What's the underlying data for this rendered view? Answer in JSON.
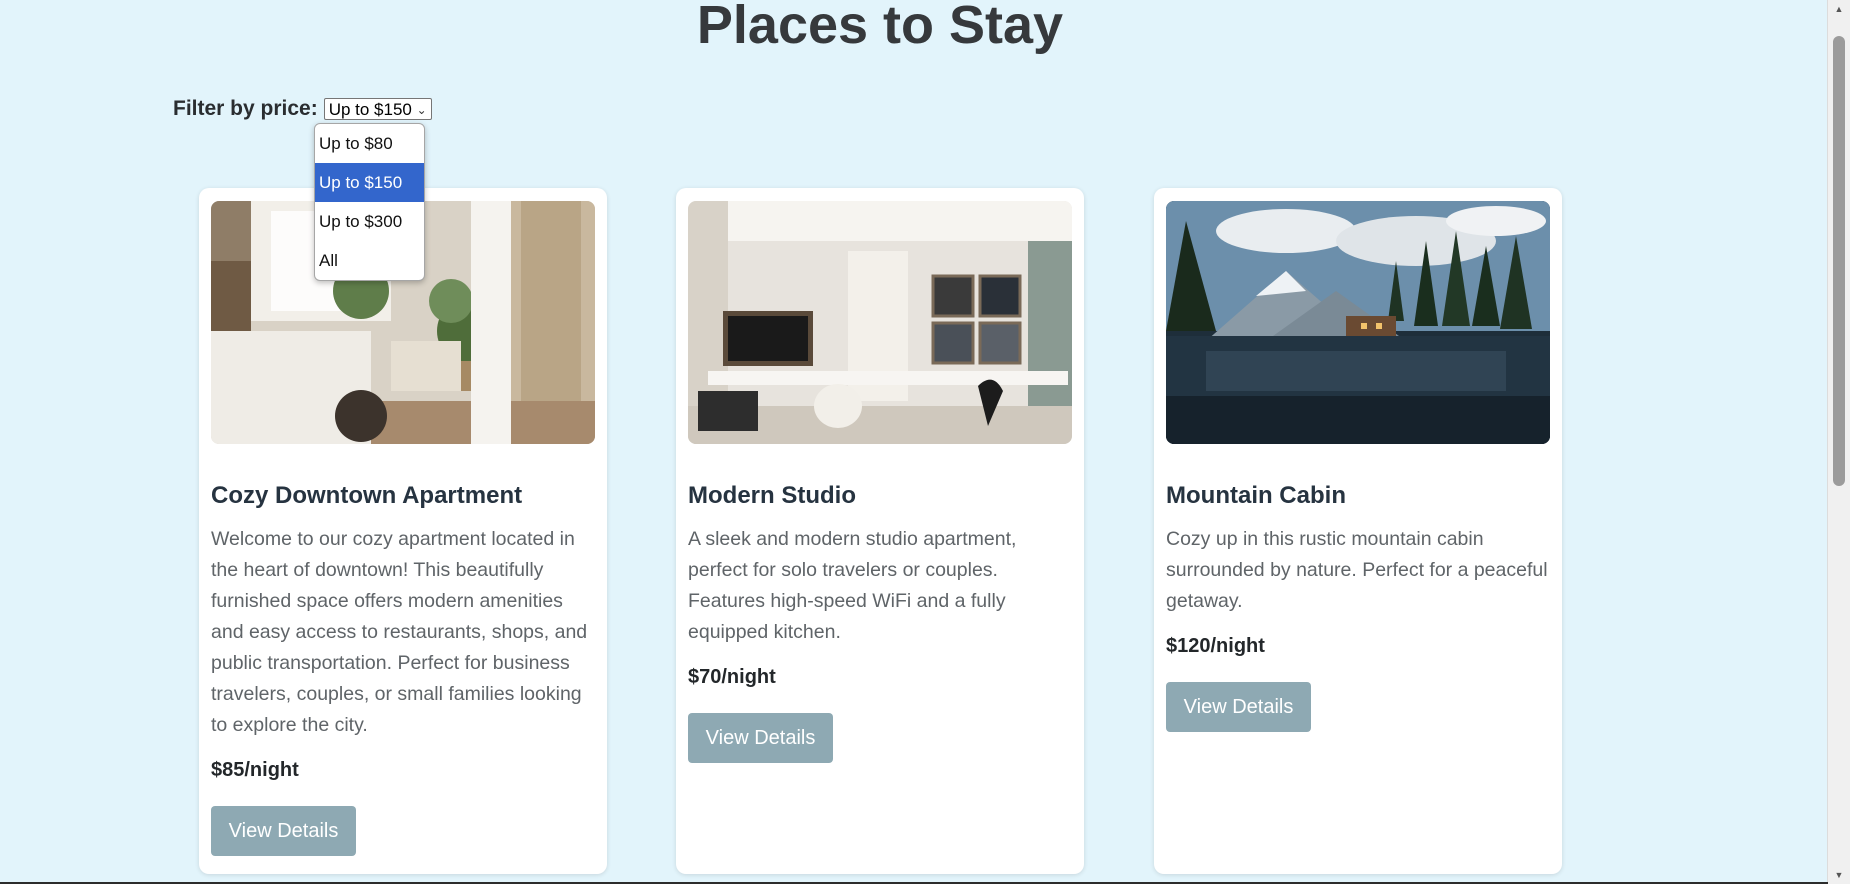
{
  "page": {
    "title": "Places to Stay"
  },
  "filter": {
    "label": "Filter by price:",
    "selected": "Up to $150",
    "options": [
      {
        "label": "Up to $80"
      },
      {
        "label": "Up to $150"
      },
      {
        "label": "Up to $300"
      },
      {
        "label": "All"
      }
    ]
  },
  "listings": [
    {
      "title": "Cozy Downtown Apartment",
      "description": "Welcome to our cozy apartment located in the heart of downtown! This beautifully furnished space offers modern amenities and easy access to restaurants, shops, and public transportation. Perfect for business travelers, couples, or small families looking to explore the city.",
      "price": "$85/night",
      "button_label": "View Details"
    },
    {
      "title": "Modern Studio",
      "description": "A sleek and modern studio apartment, perfect for solo travelers or couples. Features high-speed WiFi and a fully equipped kitchen.",
      "price": "$70/night",
      "button_label": "View Details"
    },
    {
      "title": "Mountain Cabin",
      "description": "Cozy up in this rustic mountain cabin surrounded by nature. Perfect for a peaceful getaway.",
      "price": "$120/night",
      "button_label": "View Details"
    }
  ],
  "colors": {
    "background": "#e2f4fb",
    "button": "#8ea9b3",
    "selected_option": "#3366cc"
  }
}
